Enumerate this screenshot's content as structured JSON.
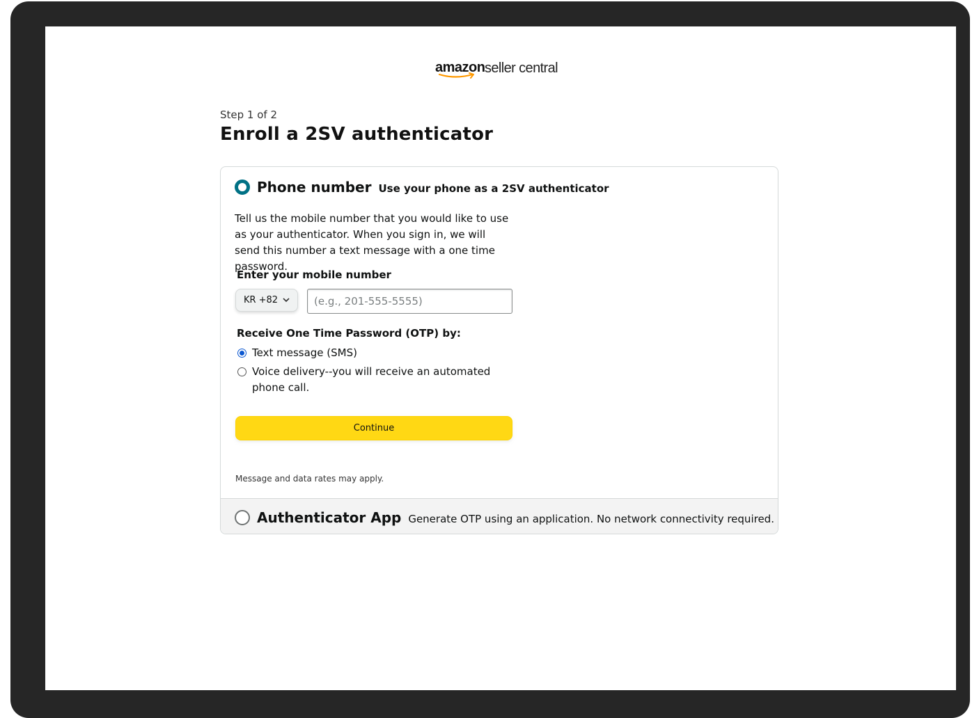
{
  "logo": {
    "brand": "amazon",
    "product": "seller central"
  },
  "step": {
    "label": "Step 1 of 2"
  },
  "page": {
    "title": "Enroll a 2SV authenticator"
  },
  "phone_option": {
    "title": "Phone number",
    "subtitle": "Use your phone as a 2SV authenticator",
    "selected": true,
    "description": "Tell us the mobile number that you would like to use as your authenticator. When you sign in, we will send this number a text message with a one time password.",
    "mobile_label": "Enter your mobile number",
    "country_code": "KR +82",
    "phone_value": "",
    "phone_placeholder": "(e.g., 201-555-5555)",
    "otp_label": "Receive One Time Password (OTP) by:",
    "otp_options": [
      {
        "label": "Text message (SMS)",
        "selected": true
      },
      {
        "label": "Voice delivery--you will receive an automated phone call.",
        "selected": false
      }
    ],
    "continue_label": "Continue",
    "rates_note": "Message and data rates may apply."
  },
  "app_option": {
    "title": "Authenticator App",
    "subtitle": "Generate OTP using an application. No network connectivity required.",
    "selected": false
  },
  "colors": {
    "device_frame": "#262626",
    "selected_radio": "#007185",
    "continue_button": "#ffd814",
    "sms_radio": "#0b57d0"
  },
  "icons": {
    "country_dropdown": "chevron-down-icon",
    "logo_smile": "amazon-smile-arrow"
  }
}
